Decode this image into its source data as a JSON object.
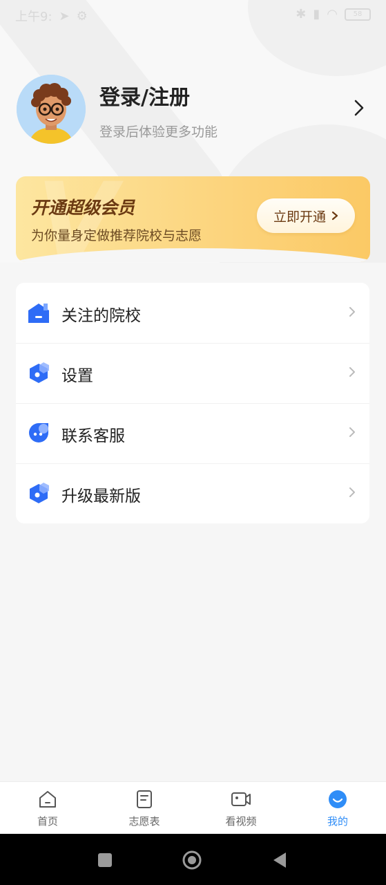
{
  "status_bar": {
    "time": "上午9:",
    "battery": "58"
  },
  "profile": {
    "title": "登录/注册",
    "subtitle": "登录后体验更多功能"
  },
  "vip": {
    "title": "开通超级会员",
    "subtitle": "为你量身定做推荐院校与志愿",
    "button_label": "立即开通",
    "accent_color": "#fbc965"
  },
  "menu": {
    "items": [
      {
        "label": "关注的院校",
        "icon": "school-icon"
      },
      {
        "label": "设置",
        "icon": "settings-icon"
      },
      {
        "label": "联系客服",
        "icon": "customer-service-icon"
      },
      {
        "label": "升级最新版",
        "icon": "upgrade-icon"
      }
    ]
  },
  "tab_bar": {
    "tabs": [
      {
        "label": "首页",
        "icon": "home-icon"
      },
      {
        "label": "志愿表",
        "icon": "form-icon"
      },
      {
        "label": "看视频",
        "icon": "video-icon"
      },
      {
        "label": "我的",
        "icon": "profile-icon",
        "active": true
      }
    ],
    "active_color": "#2f8df7"
  }
}
